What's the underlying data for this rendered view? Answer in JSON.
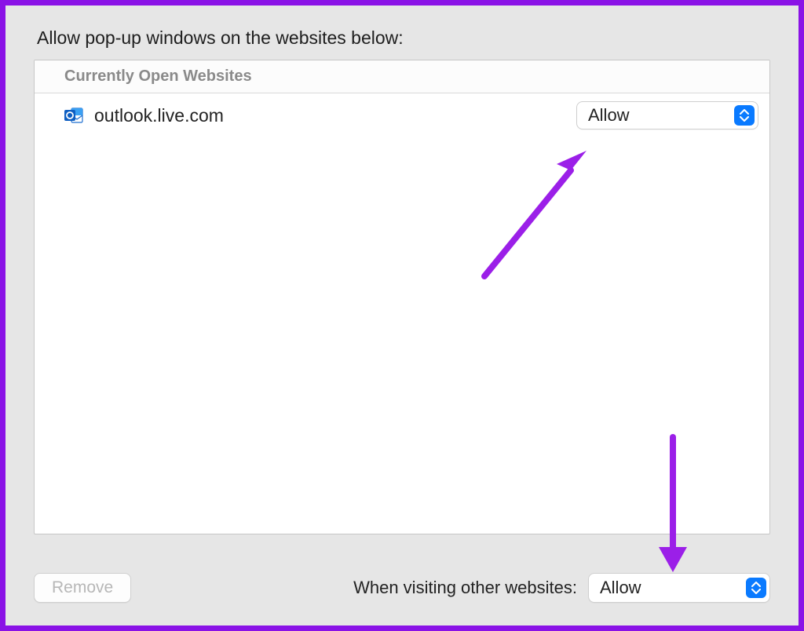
{
  "heading": "Allow pop-up windows on the websites below:",
  "section_header": "Currently Open Websites",
  "sites": [
    {
      "domain": "outlook.live.com",
      "setting": "Allow",
      "favicon": "outlook-icon"
    }
  ],
  "footer": {
    "remove_label": "Remove",
    "other_sites_label": "When visiting other websites:",
    "other_sites_setting": "Allow"
  },
  "colors": {
    "frame_border": "#8a12e6",
    "panel_bg": "#e6e6e6",
    "accent_blue": "#0a7aff",
    "annotation_purple": "#9b1fe8"
  }
}
